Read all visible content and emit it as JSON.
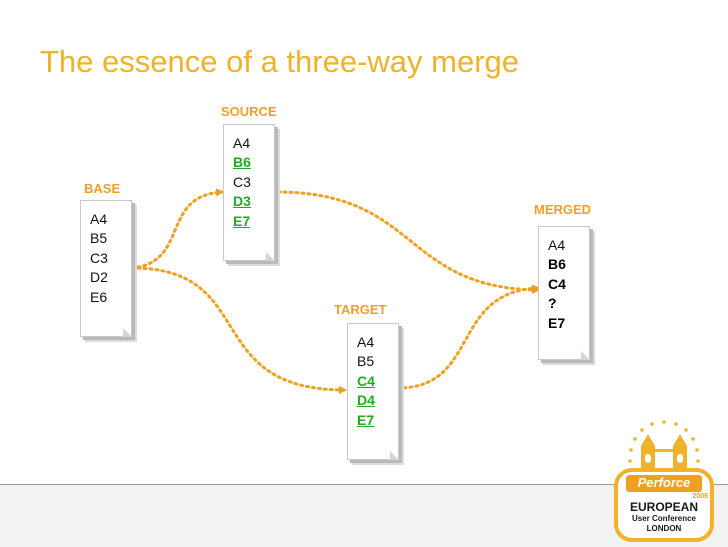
{
  "title": "The essence of a three-way merge",
  "colors": {
    "title": "#f0b22a",
    "label": "#eea028",
    "arrow": "#f0a020",
    "changed": "#22aa22"
  },
  "documents": {
    "base": {
      "label": "BASE",
      "lines": [
        {
          "text": "A4",
          "style": "normal"
        },
        {
          "text": "B5",
          "style": "normal"
        },
        {
          "text": "C3",
          "style": "normal"
        },
        {
          "text": "D2",
          "style": "normal"
        },
        {
          "text": "E6",
          "style": "normal"
        }
      ]
    },
    "source": {
      "label": "SOURCE",
      "lines": [
        {
          "text": "A4",
          "style": "normal"
        },
        {
          "text": "B6",
          "style": "changed"
        },
        {
          "text": "C3",
          "style": "normal"
        },
        {
          "text": "D3",
          "style": "changed"
        },
        {
          "text": "E7",
          "style": "changed"
        }
      ]
    },
    "target": {
      "label": "TARGET",
      "lines": [
        {
          "text": "A4",
          "style": "normal"
        },
        {
          "text": "B5",
          "style": "normal"
        },
        {
          "text": "C4",
          "style": "changed"
        },
        {
          "text": "D4",
          "style": "changed"
        },
        {
          "text": "E7",
          "style": "changed"
        }
      ]
    },
    "merged": {
      "label": "MERGED",
      "lines": [
        {
          "text": "A4",
          "style": "normal"
        },
        {
          "text": "B6",
          "style": "merged"
        },
        {
          "text": "C4",
          "style": "merged"
        },
        {
          "text": "?",
          "style": "merged"
        },
        {
          "text": "E7",
          "style": "merged"
        }
      ]
    }
  },
  "logo": {
    "brand": "Perforce",
    "year": "2006",
    "line1": "EUROPEAN",
    "line2": "User Conference",
    "line3": "LONDON"
  }
}
